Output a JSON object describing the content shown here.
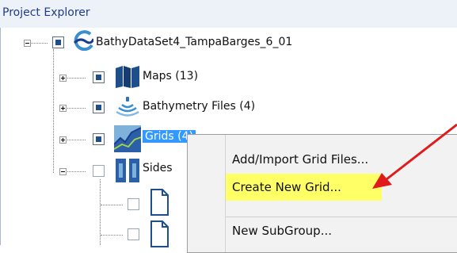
{
  "panel": {
    "title": "Project Explorer"
  },
  "tree": {
    "root_label": "BathyDataSet4_TampaBarges_6_01",
    "items": [
      {
        "label": "Maps (13)"
      },
      {
        "label": "Bathymetry Files (4)"
      },
      {
        "label": "Grids (4)"
      },
      {
        "label": "Sides"
      }
    ]
  },
  "context_menu": {
    "items": [
      {
        "label": "Add/Import Grid Files..."
      },
      {
        "label": "Create New Grid..."
      },
      {
        "label": "New SubGroup..."
      }
    ],
    "highlighted_index": 1
  },
  "colors": {
    "selection": "#3399ff",
    "highlight": "#ffff66",
    "annotation_arrow": "#e01b1b",
    "header_bg": "#edf2f9",
    "header_text": "#1f3c8a"
  }
}
